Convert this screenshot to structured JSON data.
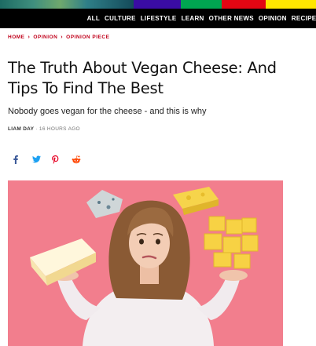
{
  "header": {
    "stripe_colors": [
      "#3a0ca3",
      "#00a651",
      "#e30613",
      "#ffe600",
      "#111111"
    ],
    "nav": [
      "ALL",
      "CULTURE",
      "LIFESTYLE",
      "LEARN",
      "OTHER NEWS",
      "OPINION",
      "RECIPES"
    ]
  },
  "breadcrumb": {
    "items": [
      "HOME",
      "OPINION",
      "OPINION PIECE"
    ],
    "separator": "›"
  },
  "article": {
    "title": "The Truth About Vegan Cheese: And Tips To Find The Best",
    "subtitle": "Nobody goes vegan for the cheese - and this is why",
    "author": "LIAM DAY",
    "byline_sep": " · ",
    "time": "16 HOURS AGO"
  },
  "share": {
    "icons": [
      "facebook-icon",
      "twitter-icon",
      "pinterest-icon",
      "reddit-icon"
    ],
    "colors": {
      "facebook": "#3b5998",
      "twitter": "#1da1f2",
      "pinterest": "#e60023",
      "reddit": "#ff4500"
    }
  },
  "hero": {
    "background": "#f27e8d"
  }
}
